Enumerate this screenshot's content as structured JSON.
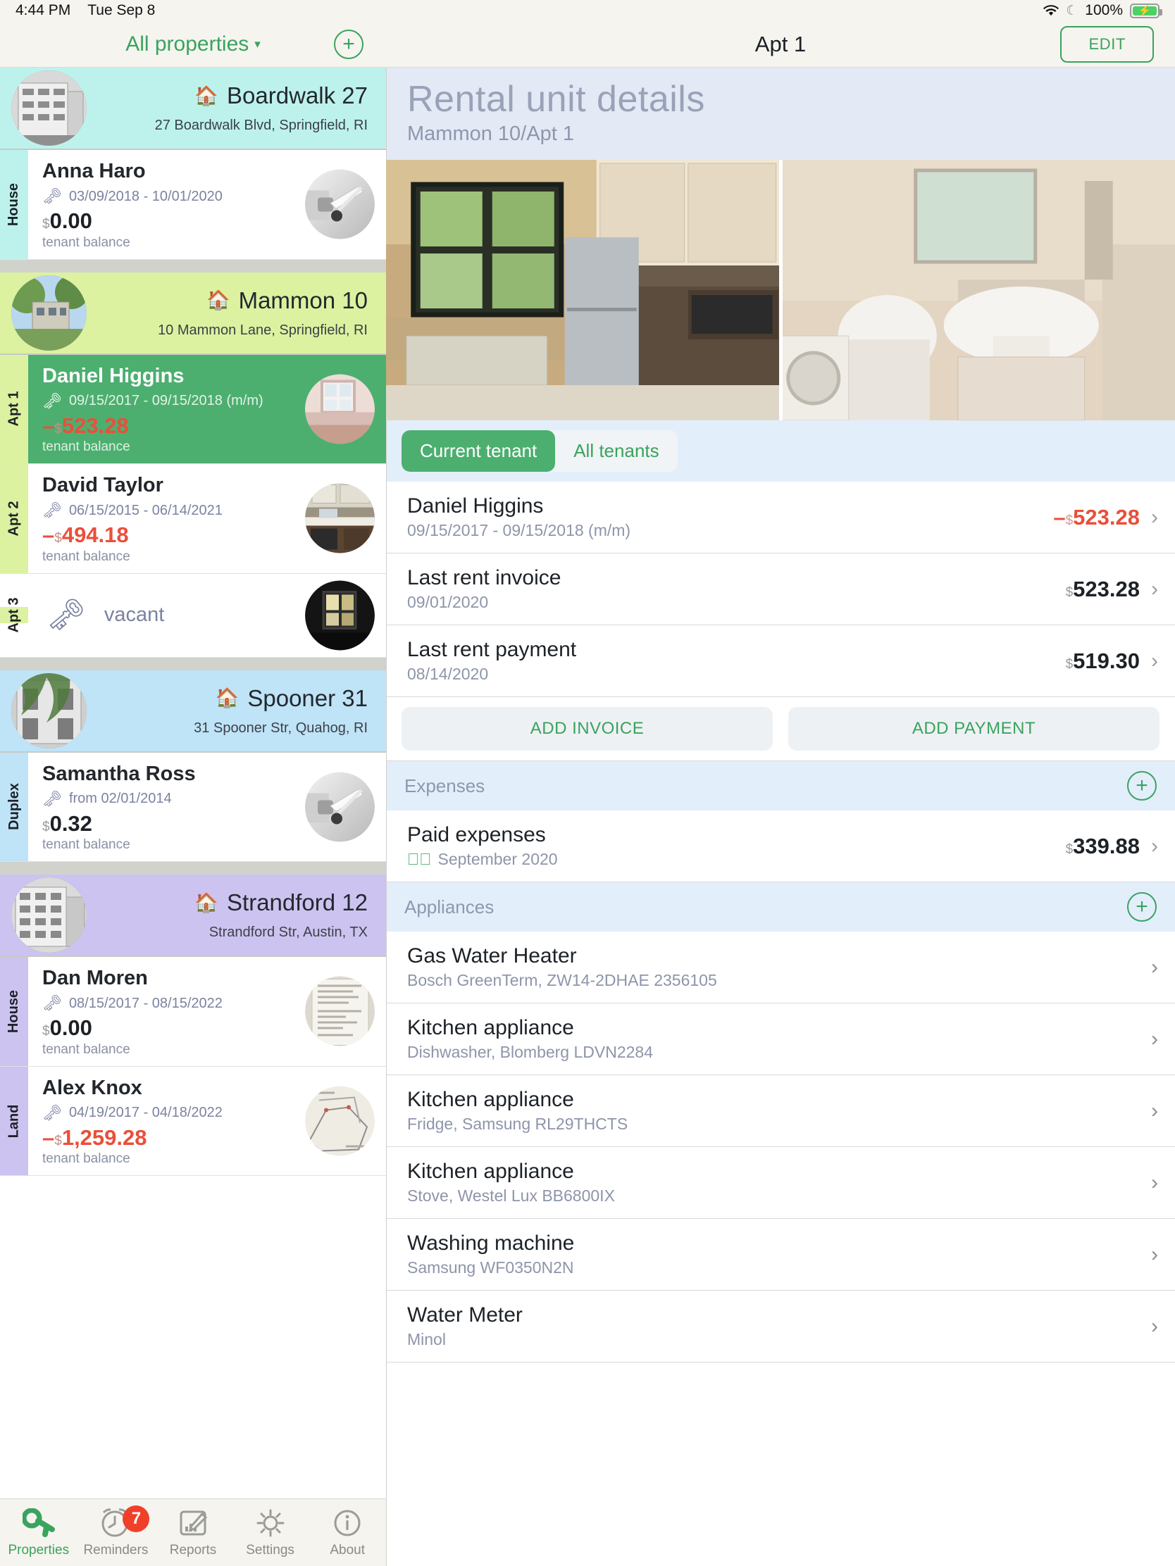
{
  "statusbar": {
    "time": "4:44 PM",
    "date": "Tue Sep 8",
    "battery_pct": "100%",
    "wifi_icon": "wifi-icon",
    "moon_icon": "moon-icon",
    "battery_icon": "battery-charging-icon"
  },
  "left": {
    "nav": {
      "filter_label": "All properties",
      "caret": "▾",
      "add_label": "+"
    },
    "properties": [
      {
        "name": "Boardwalk 27",
        "address": "27 Boardwalk Blvd, Springfield, RI",
        "accent": "#bdf2ec",
        "units": [
          {
            "tag": "House",
            "tenant": "Anna Haro",
            "dates": "03/09/2018 - 10/01/2020",
            "currency": "$",
            "balance": "0.00",
            "negative": false,
            "sub": "tenant balance",
            "selected": false,
            "photo": "door-handle"
          }
        ]
      },
      {
        "name": "Mammon 10",
        "address": "10 Mammon Lane, Springfield, RI",
        "accent": "#dcf2a0",
        "units": [
          {
            "tag": "Apt 1",
            "tenant": "Daniel Higgins",
            "dates": "09/15/2017 - 09/15/2018 (m/m)",
            "currency": "$",
            "balance": "523.28",
            "minus": "–",
            "negative": true,
            "sub": "tenant balance",
            "selected": true,
            "photo": "room"
          },
          {
            "tag": "Apt 2",
            "tenant": "David Taylor",
            "dates": "06/15/2015 - 06/14/2021",
            "currency": "$",
            "balance": "494.18",
            "minus": "–",
            "negative": true,
            "sub": "tenant balance",
            "selected": false,
            "photo": "kitchen"
          },
          {
            "tag": "Apt 3",
            "vacant_label": "vacant",
            "vacant": true,
            "selected": false,
            "photo": "dark-room"
          }
        ]
      },
      {
        "name": "Spooner 31",
        "address": "31 Spooner Str, Quahog, RI",
        "accent": "#bfe3f7",
        "units": [
          {
            "tag": "Duplex",
            "tenant": "Samantha Ross",
            "dates": "from 02/01/2014",
            "currency": "$",
            "balance": "0.32",
            "negative": false,
            "sub": "tenant balance",
            "selected": false,
            "photo": "door-handle"
          }
        ]
      },
      {
        "name": "Strandford 12",
        "address": "Strandford Str, Austin, TX",
        "accent": "#cdc3f0",
        "units": [
          {
            "tag": "House",
            "tenant": "Dan Moren",
            "dates": "08/15/2017 - 08/15/2022",
            "currency": "$",
            "balance": "0.00",
            "negative": false,
            "sub": "tenant balance",
            "selected": false,
            "photo": "document"
          },
          {
            "tag": "Land",
            "tenant": "Alex Knox",
            "dates": "04/19/2017 - 04/18/2022",
            "currency": "$",
            "balance": "1,259.28",
            "minus": "–",
            "negative": true,
            "sub": "tenant balance",
            "selected": false,
            "photo": "map"
          }
        ]
      }
    ],
    "tabbar": [
      {
        "label": "Properties",
        "icon": "key-icon",
        "active": true,
        "badge": null
      },
      {
        "label": "Reminders",
        "icon": "clock-icon",
        "active": false,
        "badge": "7"
      },
      {
        "label": "Reports",
        "icon": "chart-edit-icon",
        "active": false,
        "badge": null
      },
      {
        "label": "Settings",
        "icon": "gear-icon",
        "active": false,
        "badge": null
      },
      {
        "label": "About",
        "icon": "info-icon",
        "active": false,
        "badge": null
      }
    ]
  },
  "right": {
    "nav": {
      "title": "Apt 1",
      "edit_label": "EDIT"
    },
    "detail": {
      "title": "Rental unit details",
      "subtitle": "Mammon 10/Apt 1"
    },
    "photos": [
      {
        "name": "kitchen-photo"
      },
      {
        "name": "bathroom-photo"
      }
    ],
    "tenant_tabs": [
      {
        "label": "Current tenant",
        "active": true
      },
      {
        "label": "All tenants",
        "active": false
      }
    ],
    "tenant_rows": [
      {
        "title": "Daniel Higgins",
        "sub": "09/15/2017 - 09/15/2018 (m/m)",
        "currency": "$",
        "value": "523.28",
        "minus": "–",
        "negative": true
      },
      {
        "title": "Last rent invoice",
        "sub": "09/01/2020",
        "currency": "$",
        "value": "523.28",
        "negative": false
      },
      {
        "title": "Last rent payment",
        "sub": "08/14/2020",
        "currency": "$",
        "value": "519.30",
        "negative": false
      }
    ],
    "actions": [
      {
        "label": "ADD INVOICE"
      },
      {
        "label": "ADD PAYMENT"
      }
    ],
    "expenses": {
      "section_title": "Expenses",
      "add_label": "+",
      "row": {
        "title": "Paid expenses",
        "sub": "September 2020",
        "currency": "$",
        "value": "339.88",
        "check_icon": "check-circle-icon"
      }
    },
    "appliances": {
      "section_title": "Appliances",
      "add_label": "+",
      "items": [
        {
          "title": "Gas Water Heater",
          "sub": "Bosch GreenTerm, ZW14-2DHAE 2356105"
        },
        {
          "title": "Kitchen appliance",
          "sub": "Dishwasher, Blomberg LDVN2284"
        },
        {
          "title": "Kitchen appliance",
          "sub": "Fridge, Samsung RL29THCTS"
        },
        {
          "title": "Kitchen appliance",
          "sub": "Stove, Westel Lux BB6800IX"
        },
        {
          "title": "Washing machine",
          "sub": "Samsung WF0350N2N"
        },
        {
          "title": "Water Meter",
          "sub": "Minol"
        }
      ]
    }
  },
  "colors": {
    "green": "#3aa35e",
    "green_fill": "#4caf6f",
    "red": "#ea4f3a",
    "badge_red": "#f0402a",
    "header_blue": "#e3e9f5",
    "section_blue": "#e3eefb"
  }
}
